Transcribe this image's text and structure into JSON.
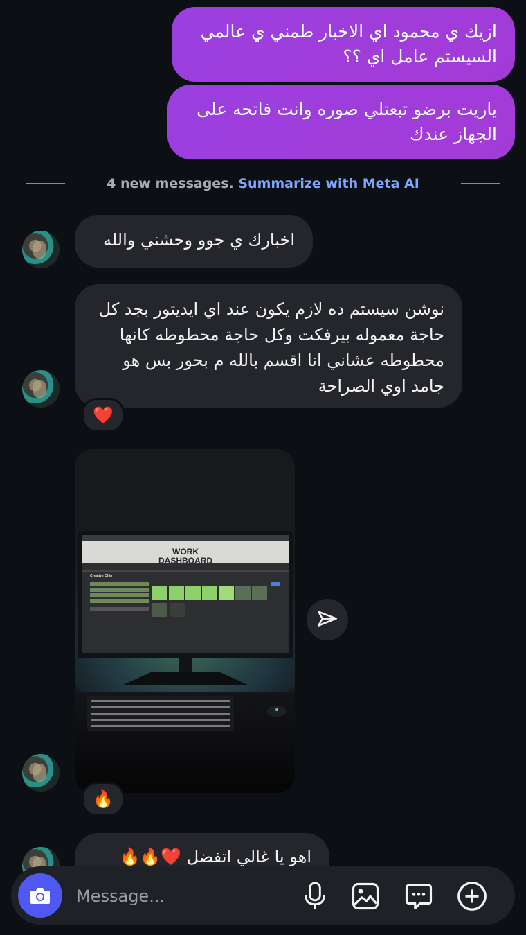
{
  "messages_out": [
    {
      "text": "ازيك ي محمود اي الاخبار طمني ي عالمي السيستم عامل اي ؟؟"
    },
    {
      "text": "ياريت برضو تبعتلي صوره وانت فاتحه على الجهاز عندك"
    }
  ],
  "divider": {
    "count_text": "4 new messages.",
    "link_text": "Summarize with Meta AI"
  },
  "messages_in": [
    {
      "text": "اخبارك ي جوو وحشني والله"
    },
    {
      "text": "نوشن سيستم ده لازم يكون عند اي ايديتور بجد كل حاجة معموله بيرفكت وكل حاجة محطوطه كانها محطوطه عشاني انا اقسم بالله م بحور بس هو جامد اوي الصراحة",
      "reaction": "❤️"
    },
    {
      "reaction": "🔥"
    },
    {
      "text": "اهو يا غالي اتفضل ❤️🔥🔥"
    }
  ],
  "photo": {
    "screen_title_line1": "WORK",
    "screen_title_line2": "DASHBOARD",
    "screen_heading": "Creative Chip"
  },
  "composer": {
    "placeholder": "Message..."
  },
  "icons": {
    "camera": "camera-icon",
    "mic": "microphone-icon",
    "gallery": "image-icon",
    "sticker": "chat-bubble-icon",
    "add": "plus-circle-icon",
    "share": "send-icon"
  },
  "colors": {
    "outgoing_bubble": "#9b3fe0",
    "incoming_bubble": "#24262b",
    "background": "#0c1014",
    "link": "#7fa6ff",
    "camera_button": "#4f59f2"
  }
}
